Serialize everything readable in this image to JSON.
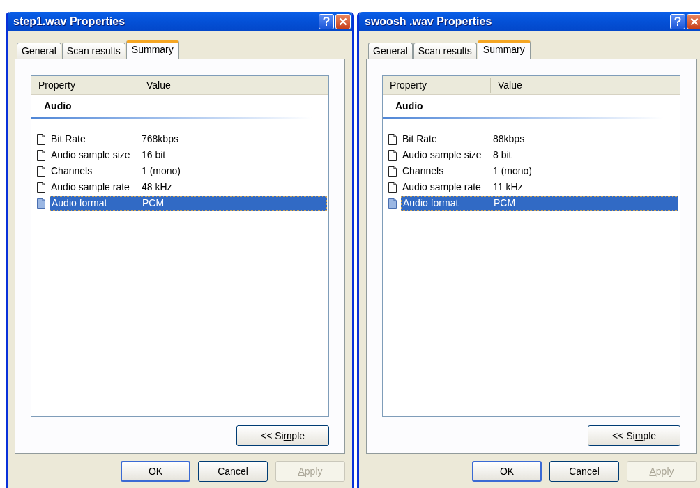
{
  "dialogs": [
    {
      "title": "step1.wav Properties",
      "tabs": [
        {
          "label": "General",
          "selected": false
        },
        {
          "label": "Scan results",
          "selected": false
        },
        {
          "label": "Summary",
          "selected": true
        }
      ],
      "columns": [
        "Property",
        "Value"
      ],
      "group": "Audio",
      "rows": [
        {
          "property": "Bit Rate",
          "value": "768kbps",
          "selected": false
        },
        {
          "property": "Audio sample size",
          "value": "16 bit",
          "selected": false
        },
        {
          "property": "Channels",
          "value": "1 (mono)",
          "selected": false
        },
        {
          "property": "Audio sample rate",
          "value": "48 kHz",
          "selected": false
        },
        {
          "property": "Audio format",
          "value": "PCM",
          "selected": true
        }
      ],
      "toggle_button": {
        "label": {
          "before": "<< Si",
          "accel": "m",
          "after": "ple"
        }
      },
      "buttons": [
        {
          "label": {
            "before": "OK"
          },
          "disabled": false
        },
        {
          "label": {
            "before": "Cancel"
          },
          "disabled": false
        },
        {
          "label": {
            "accel": "A",
            "after": "pply"
          },
          "disabled": true
        }
      ]
    },
    {
      "title": "swoosh .wav Properties",
      "tabs": [
        {
          "label": "General",
          "selected": false
        },
        {
          "label": "Scan results",
          "selected": false
        },
        {
          "label": "Summary",
          "selected": true
        }
      ],
      "columns": [
        "Property",
        "Value"
      ],
      "group": "Audio",
      "rows": [
        {
          "property": "Bit Rate",
          "value": "88kbps",
          "selected": false
        },
        {
          "property": "Audio sample size",
          "value": "8 bit",
          "selected": false
        },
        {
          "property": "Channels",
          "value": "1 (mono)",
          "selected": false
        },
        {
          "property": "Audio sample rate",
          "value": "11 kHz",
          "selected": false
        },
        {
          "property": "Audio format",
          "value": "PCM",
          "selected": true
        }
      ],
      "toggle_button": {
        "label": {
          "before": "<< Si",
          "accel": "m",
          "after": "ple"
        }
      },
      "buttons": [
        {
          "label": {
            "before": "OK"
          },
          "disabled": false
        },
        {
          "label": {
            "before": "Cancel"
          },
          "disabled": false
        },
        {
          "label": {
            "accel": "A",
            "after": "pply"
          },
          "disabled": true
        }
      ]
    }
  ]
}
